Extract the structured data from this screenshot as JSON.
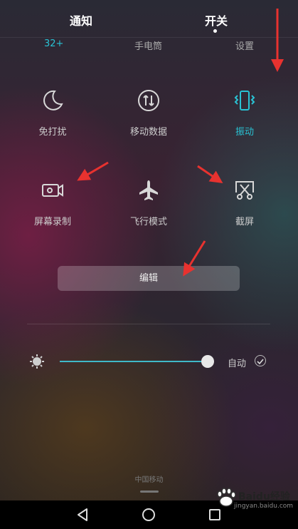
{
  "tabs": {
    "notifications": "通知",
    "switches": "开关"
  },
  "top_row": {
    "badge": "32+",
    "flashlight": "手电筒",
    "settings": "设置"
  },
  "toggles": [
    {
      "label": "免打扰",
      "icon": "moon-icon",
      "active": false
    },
    {
      "label": "移动数据",
      "icon": "mobile-data-icon",
      "active": false
    },
    {
      "label": "振动",
      "icon": "vibrate-icon",
      "active": true
    },
    {
      "label": "屏幕录制",
      "icon": "screen-record-icon",
      "active": false
    },
    {
      "label": "飞行模式",
      "icon": "airplane-icon",
      "active": false
    },
    {
      "label": "截屏",
      "icon": "screenshot-icon",
      "active": false
    }
  ],
  "edit_button": "编辑",
  "brightness": {
    "auto_label": "自动",
    "level": 0.98,
    "auto_checked": true
  },
  "carrier": "中国移动",
  "colors": {
    "accent": "#29c3d4",
    "annotation_arrow": "#e8322f"
  },
  "watermark": {
    "brand": "Baidu经验",
    "url": "jingyan.baidu.com"
  }
}
